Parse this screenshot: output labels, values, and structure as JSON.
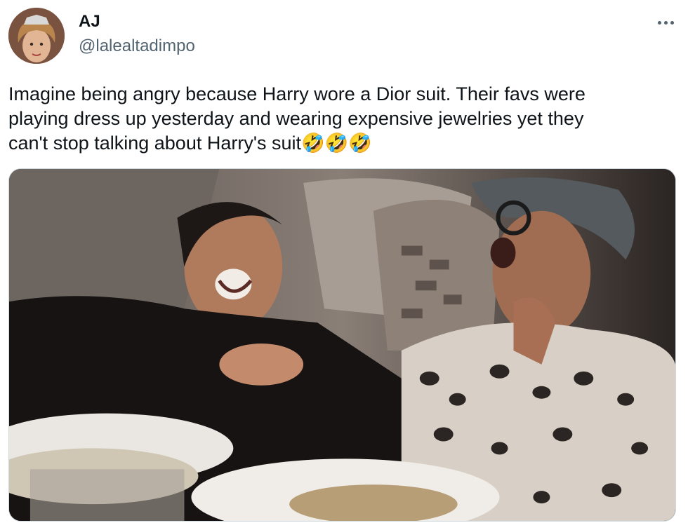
{
  "tweet": {
    "author": {
      "display_name": "AJ",
      "handle": "@lalealtadimpo",
      "avatar_icon": "profile-avatar"
    },
    "more_icon": "ellipsis-icon",
    "text": "Imagine being angry because Harry wore a Dior suit. Their favs were\nplaying dress up yesterday and wearing expensive jewelries yet they\ncan't stop talking about Harry's suit🤣🤣🤣",
    "media": {
      "type": "image",
      "accent_colors": {
        "background": "#3a3431",
        "border": "#cfd9de"
      }
    }
  },
  "colors": {
    "text_primary": "#0f1419",
    "text_secondary": "#536471"
  }
}
